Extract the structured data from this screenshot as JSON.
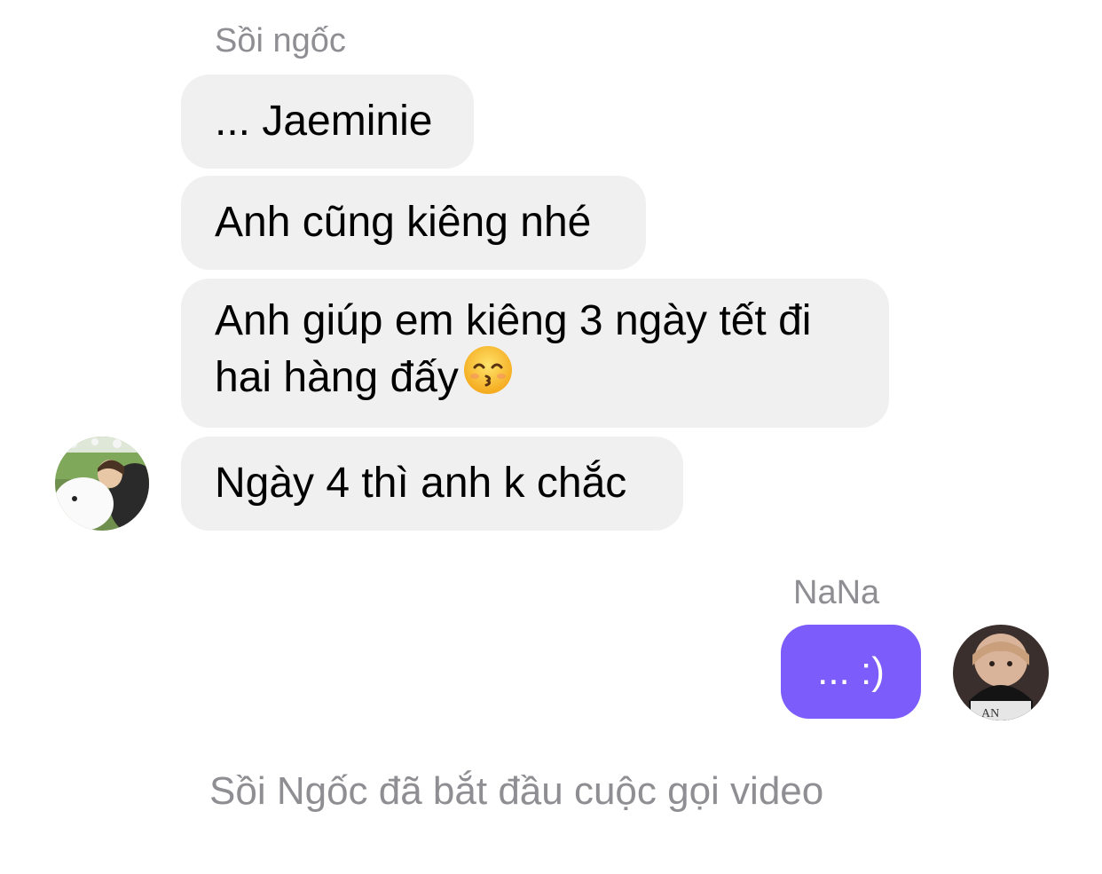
{
  "thread": {
    "incoming_sender": "Sồi ngốc",
    "incoming_messages": [
      {
        "text": "... Jaeminie"
      },
      {
        "text": "Anh cũng kiêng nhé"
      },
      {
        "text": "Anh giúp em kiêng 3 ngày tết đi\nhai hàng đấy",
        "emoji": "kissing-smiling-eyes-emoji"
      },
      {
        "text": "Ngày 4 thì anh k chắc"
      }
    ],
    "outgoing_sender": "NaNa",
    "outgoing_messages": [
      {
        "text": "... :)"
      }
    ],
    "system_note": "Sồi Ngốc đã bắt đầu cuộc gọi video"
  },
  "colors": {
    "incoming_bubble": "#f0f0f0",
    "outgoing_bubble": "#7c5cfa",
    "meta_text": "#8e8e93"
  },
  "icons": {
    "incoming_avatar": "avatar-photo",
    "outgoing_avatar": "avatar-photo"
  }
}
